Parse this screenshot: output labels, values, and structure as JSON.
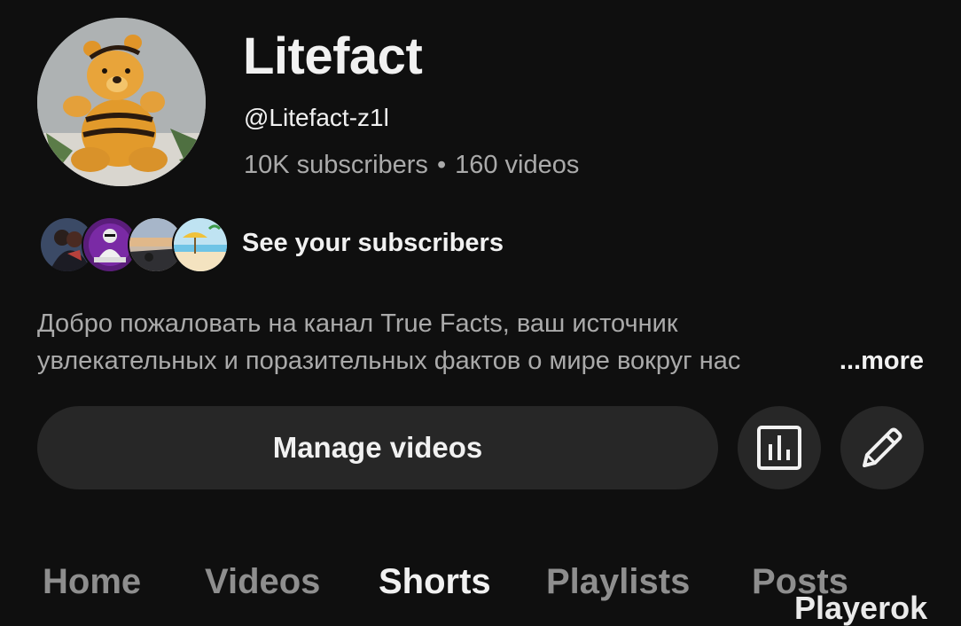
{
  "channel": {
    "name": "Litefact",
    "handle": "@Litefact-z1l",
    "subscribers": "10K subscribers",
    "separator": "•",
    "videos": "160 videos"
  },
  "subscribers_link": {
    "label": "See your subscribers",
    "avatars": [
      "subscriber-avatar-couple",
      "subscriber-avatar-dj",
      "subscriber-avatar-sunset",
      "subscriber-avatar-beach"
    ]
  },
  "description": {
    "line1": "Добро пожаловать на канал True Facts, ваш источник",
    "line2": "увлекательных и поразительных фактов о мире вокруг нас",
    "more_label": "...more"
  },
  "actions": {
    "manage_label": "Manage videos",
    "analytics_icon": "analytics-icon",
    "edit_icon": "pencil-icon"
  },
  "tabs": [
    {
      "label": "Home",
      "active": false
    },
    {
      "label": "Videos",
      "active": false
    },
    {
      "label": "Shorts",
      "active": true
    },
    {
      "label": "Playlists",
      "active": false
    },
    {
      "label": "Posts",
      "active": false
    }
  ],
  "watermark": "Playerok",
  "colors": {
    "background": "#0f0f0f",
    "button": "#272727",
    "primary_text": "#f1f1f1",
    "secondary_text": "#aaaaaa"
  }
}
